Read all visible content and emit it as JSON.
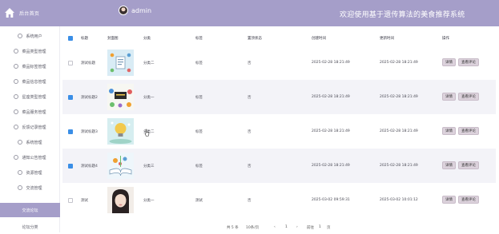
{
  "header": {
    "system_title": "后台首页",
    "username": "admin",
    "welcome": "欢迎使用基于遗传算法的美食推荐系统"
  },
  "sidebar": {
    "items": [
      {
        "label": "系统用户"
      },
      {
        "label": "菜品类型管理"
      },
      {
        "label": "菜品标签管理"
      },
      {
        "label": "菜品信息管理"
      },
      {
        "label": "星座类型管理"
      },
      {
        "label": "菜品服务管理"
      },
      {
        "label": "反馈记录管理"
      },
      {
        "label": "系统管理"
      },
      {
        "label": "通知公告管理"
      },
      {
        "label": "资源管理"
      },
      {
        "label": "交流管理"
      },
      {
        "label": "交流论坛"
      },
      {
        "label": "论坛分类"
      }
    ],
    "active_index": 11
  },
  "table": {
    "headers": {
      "title": "标题",
      "cover": "封面图",
      "category": "分类",
      "tag": "标签",
      "recommend": "置顶状态",
      "created": "创建时间",
      "updated": "更新时间",
      "actions": "操作"
    },
    "rows": [
      {
        "checked": false,
        "title": "测试标题",
        "cover": "food-icons",
        "category": "分类二",
        "tag": "标签",
        "recommend": "否",
        "created": "2025-02-28 18:21:49",
        "updated": "2025-02-28 18:21:49",
        "btn_detail": "详情",
        "btn_comment": "查看评论"
      },
      {
        "checked": true,
        "title": "测试标题2",
        "cover": "idea-people",
        "category": "分类一",
        "tag": "标签",
        "recommend": "否",
        "created": "2025-02-28 18:21:49",
        "updated": "2025-02-28 18:21:49",
        "btn_detail": "详情",
        "btn_comment": "查看评论"
      },
      {
        "checked": true,
        "title": "测试标题3",
        "cover": "lightbulb",
        "category": "分类二",
        "tag": "标签",
        "recommend": "否",
        "created": "2025-02-28 18:21:49",
        "updated": "2025-02-28 18:21:49",
        "btn_detail": "详情",
        "btn_comment": "查看评论"
      },
      {
        "checked": true,
        "title": "测试标题4",
        "cover": "open-book",
        "category": "分类三",
        "tag": "标签",
        "recommend": "否",
        "created": "2025-02-28 18:21:49",
        "updated": "2025-02-28 18:21:49",
        "btn_detail": "详情",
        "btn_comment": "查看评论"
      },
      {
        "checked": false,
        "title": "测试",
        "cover": "portrait",
        "category": "分类一",
        "tag": "测试",
        "recommend": "否",
        "created": "2025-03-02 09:59:31",
        "updated": "2025-03-02 10:01:12",
        "btn_detail": "详情",
        "btn_comment": "查看评论"
      }
    ]
  },
  "pager": {
    "total": "共 5 条",
    "page_size": "10条/页",
    "prev": "‹",
    "page": "1",
    "next": "›",
    "goto": "前往",
    "goto_value": "1",
    "page_suffix": "页"
  },
  "colors": {
    "header_bg": "#a59ec9",
    "sidebar_active": "#a59ec9",
    "checkbox_on": "#3a8ee6",
    "button_bg": "#dcd2dc"
  }
}
